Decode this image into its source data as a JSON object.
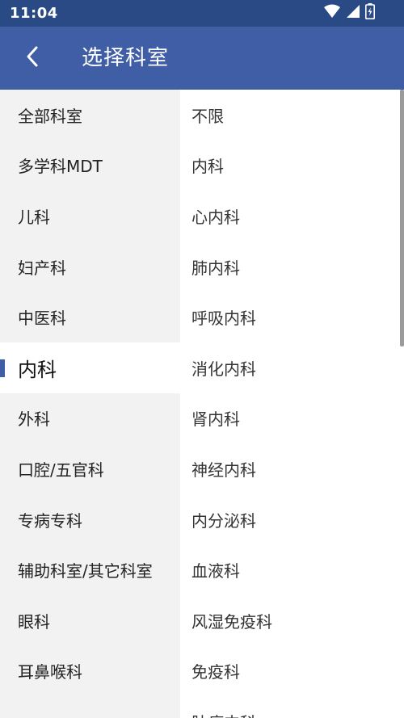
{
  "status_bar": {
    "time": "11:04"
  },
  "app_bar": {
    "title": "选择科室"
  },
  "left_list": {
    "selected_index": 5,
    "items": [
      "全部科室",
      "多学科MDT",
      "儿科",
      "妇产科",
      "中医科",
      "内科",
      "外科",
      "口腔/五官科",
      "专病专科",
      "辅助科室/其它科室",
      "眼科",
      "耳鼻喉科"
    ]
  },
  "right_list": {
    "items": [
      "不限",
      "内科",
      "心内科",
      "肺内科",
      "呼吸内科",
      "消化内科",
      "肾内科",
      "神经内科",
      "内分泌科",
      "血液科",
      "风湿免疫科",
      "免疫科",
      "肿瘤内科"
    ]
  },
  "colors": {
    "status_bar": "#2a4a86",
    "app_bar": "#3f5ea6",
    "accent": "#3f5ea6",
    "left_bg": "#f2f2f2"
  },
  "icons": [
    "wifi-icon",
    "cellular-signal-icon",
    "battery-charging-icon",
    "back-arrow-icon"
  ]
}
